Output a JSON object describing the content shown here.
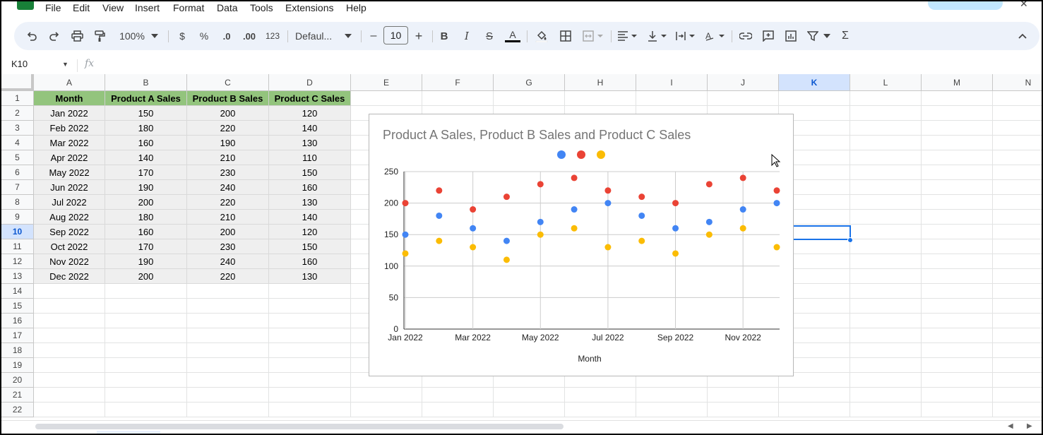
{
  "menu": [
    "File",
    "Edit",
    "View",
    "Insert",
    "Format",
    "Data",
    "Tools",
    "Extensions",
    "Help"
  ],
  "toolbar": {
    "zoom": "100%",
    "currency": "$",
    "percent": "%",
    "dec_decrease": ".0",
    "dec_increase": ".00",
    "number_format": "123",
    "font": "Defaul...",
    "font_size": "10",
    "minus": "–",
    "plus": "+",
    "bold": "B",
    "italic": "I",
    "strike": "S",
    "text_color": "A",
    "sigma": "Σ"
  },
  "formula_bar": {
    "name_box": "K10",
    "fx": "fx"
  },
  "columns": [
    "A",
    "B",
    "C",
    "D",
    "E",
    "F",
    "G",
    "H",
    "I",
    "J",
    "K",
    "L",
    "M",
    "N"
  ],
  "selected_column": "K",
  "selected_row": "10",
  "rows": [
    "1",
    "2",
    "3",
    "4",
    "5",
    "6",
    "7",
    "8",
    "9",
    "10",
    "11",
    "12",
    "13",
    "14",
    "15",
    "16",
    "17",
    "18",
    "19",
    "20",
    "21",
    "22"
  ],
  "table": {
    "headers": [
      "Month",
      "Product A Sales",
      "Product B Sales",
      "Product C Sales"
    ],
    "rows": [
      [
        "Jan 2022",
        "150",
        "200",
        "120"
      ],
      [
        "Feb 2022",
        "180",
        "220",
        "140"
      ],
      [
        "Mar 2022",
        "160",
        "190",
        "130"
      ],
      [
        "Apr 2022",
        "140",
        "210",
        "110"
      ],
      [
        "May 2022",
        "170",
        "230",
        "150"
      ],
      [
        "Jun 2022",
        "190",
        "240",
        "160"
      ],
      [
        "Jul 2022",
        "200",
        "220",
        "130"
      ],
      [
        "Aug 2022",
        "180",
        "210",
        "140"
      ],
      [
        "Sep 2022",
        "160",
        "200",
        "120"
      ],
      [
        "Oct 2022",
        "170",
        "230",
        "150"
      ],
      [
        "Nov 2022",
        "190",
        "240",
        "160"
      ],
      [
        "Dec 2022",
        "200",
        "220",
        "130"
      ]
    ]
  },
  "chart_data": {
    "type": "scatter",
    "title": "Product A Sales, Product B Sales and Product C Sales",
    "xlabel": "Month",
    "ylabel": "",
    "legend_placement": "top",
    "grid": true,
    "ylim": [
      0,
      250
    ],
    "yticks": [
      "0",
      "50",
      "100",
      "150",
      "200",
      "250"
    ],
    "y_tick_values": [
      0,
      50,
      100,
      150,
      200,
      250
    ],
    "categories": [
      "Jan 2022",
      "Feb 2022",
      "Mar 2022",
      "Apr 2022",
      "May 2022",
      "Jun 2022",
      "Jul 2022",
      "Aug 2022",
      "Sep 2022",
      "Oct 2022",
      "Nov 2022",
      "Dec 2022"
    ],
    "xtick_labels": [
      "Jan 2022",
      "Mar 2022",
      "May 2022",
      "Jul 2022",
      "Sep 2022",
      "Nov 2022"
    ],
    "series": [
      {
        "color": "#4285f4",
        "values": [
          150,
          180,
          160,
          140,
          170,
          190,
          200,
          180,
          160,
          170,
          190,
          200
        ]
      },
      {
        "color": "#ea4335",
        "values": [
          200,
          220,
          190,
          210,
          230,
          240,
          220,
          210,
          200,
          230,
          240,
          220
        ]
      },
      {
        "color": "#fbbc04",
        "values": [
          120,
          140,
          130,
          110,
          150,
          160,
          130,
          140,
          120,
          150,
          160,
          130
        ]
      }
    ]
  }
}
